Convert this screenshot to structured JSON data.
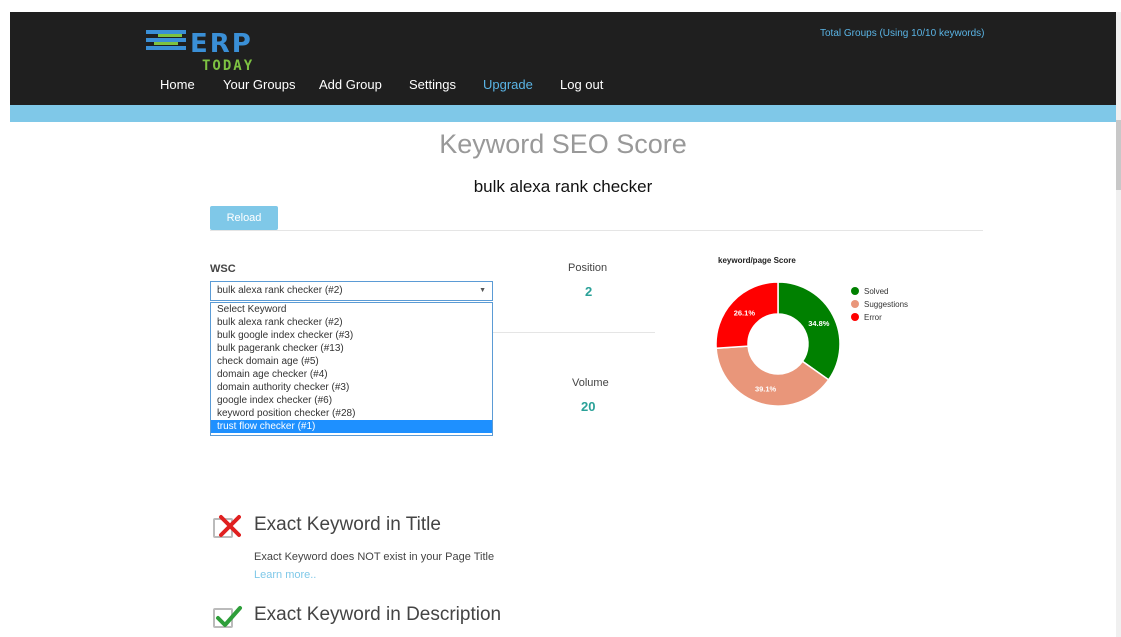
{
  "header": {
    "logo_text": "ERP",
    "logo_sub": "TODAY",
    "total_groups": "Total Groups (Using 10/10 keywords)",
    "nav": [
      "Home",
      "Your Groups",
      "Add Group",
      "Settings",
      "Upgrade",
      "Log out"
    ]
  },
  "page": {
    "title": "Keyword SEO Score",
    "keyword": "bulk alexa rank checker",
    "reload_label": "Reload"
  },
  "wsc": {
    "label": "WSC",
    "selected": "bulk alexa rank checker (#2)",
    "options": [
      "Select Keyword",
      "bulk alexa rank checker (#2)",
      "bulk google index checker (#3)",
      "bulk pagerank checker (#13)",
      "check domain age (#5)",
      "domain age checker (#4)",
      "domain authority checker (#3)",
      "google index checker (#6)",
      "keyword position checker (#28)",
      "trust flow checker (#1)"
    ],
    "highlighted_index": 9
  },
  "stats": {
    "position_label": "Position",
    "position_value": "2",
    "volume_label": "Volume",
    "volume_value": "20"
  },
  "chart_data": {
    "type": "pie",
    "title": "keyword/page Score",
    "categories": [
      "Solved",
      "Suggestions",
      "Error"
    ],
    "values": [
      34.8,
      39.1,
      26.1
    ],
    "labels": [
      "34.8%",
      "39.1%",
      "26.1%"
    ],
    "colors": [
      "#008000",
      "#e9967a",
      "#ff0000"
    ],
    "legend": "right"
  },
  "checks": [
    {
      "title": "Exact Keyword in Title",
      "status": "fail",
      "description": "Exact Keyword does NOT exist in your Page Title",
      "link": "Learn more.."
    },
    {
      "title": "Exact Keyword in Description",
      "status": "pass"
    }
  ],
  "colors": {
    "accent": "#7fc8e8",
    "header_bg": "#1f1f1f",
    "value": "#2aa198"
  }
}
